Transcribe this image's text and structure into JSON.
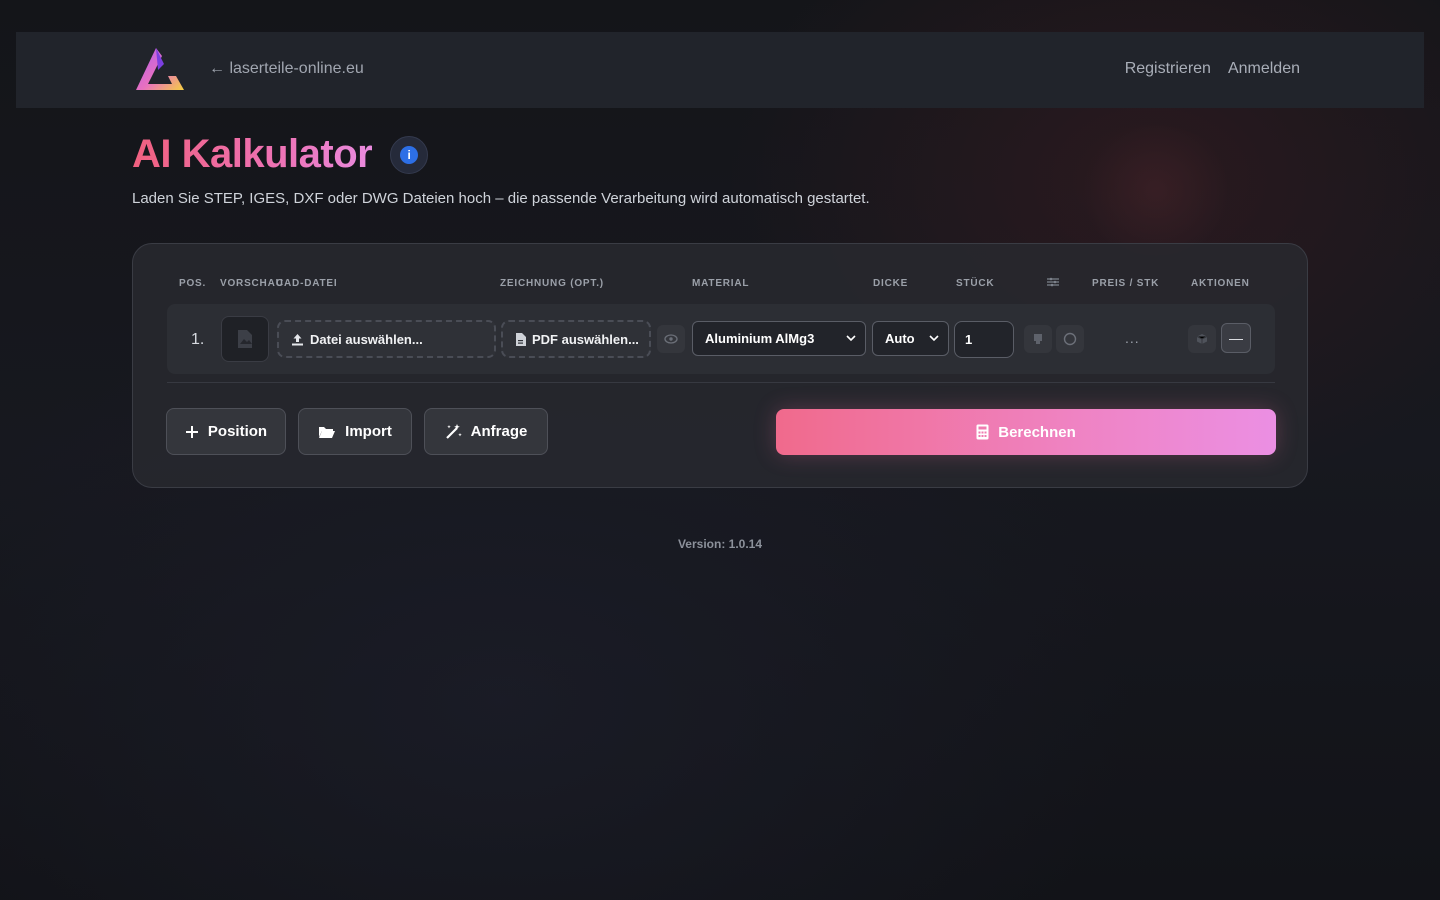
{
  "header": {
    "back_link": "← laserteile-online.eu",
    "register": "Registrieren",
    "login": "Anmelden"
  },
  "page": {
    "title": "AI Kalkulator",
    "info_glyph": "i",
    "subtitle": "Laden Sie STEP, IGES, DXF oder DWG Dateien hoch – die passende Verarbeitung wird automatisch gestartet."
  },
  "table": {
    "columns": {
      "pos": "POS.",
      "preview": "VORSCHAU",
      "cad": "CAD-DATEI",
      "drawing": "ZEICHNUNG (OPT.)",
      "material": "MATERIAL",
      "thickness": "DICKE",
      "qty": "STÜCK",
      "price": "PREIS / STK",
      "actions": "AKTIONEN"
    },
    "rows": [
      {
        "pos": "1.",
        "cad_button": "Datei auswählen...",
        "pdf_button": "PDF auswählen...",
        "material": "Aluminium AlMg3",
        "thickness": "Auto",
        "qty": "1",
        "price": "...",
        "remove": "—"
      }
    ]
  },
  "actions": {
    "add_position": "Position",
    "import": "Import",
    "request": "Anfrage",
    "calculate": "Berechnen"
  },
  "footer": {
    "version": "Version: 1.0.14"
  },
  "colors": {
    "accent_start": "#f0607f",
    "accent_end": "#e98bdf",
    "info_blue": "#2d6fe6"
  }
}
